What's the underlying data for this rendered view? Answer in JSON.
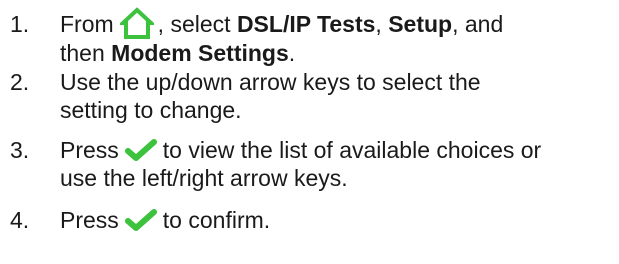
{
  "steps": [
    {
      "number": "1.",
      "before_icon": "From",
      "icon": "home-icon",
      "after_icon": ", select ",
      "bold1": "DSL/IP Tests",
      "sep1": ", ",
      "bold2": "Setup",
      "sep2": ", and",
      "line2_prefix": "then ",
      "bold3": "Modem Settings",
      "line2_suffix": "."
    },
    {
      "number": "2.",
      "line1": "Use the up/down arrow keys to select the",
      "line2": "setting to change."
    },
    {
      "number": "3.",
      "before_icon": "Press",
      "icon": "check-icon",
      "after_icon": "to view the list of available choices or",
      "line2": "use the left/right arrow keys."
    },
    {
      "number": "4.",
      "before_icon": "Press",
      "icon": "check-icon",
      "after_icon": "to confirm."
    }
  ],
  "colors": {
    "home_icon": "#3cc23c",
    "check_icon": "#3cc23c",
    "text": "#1a1a1a"
  }
}
